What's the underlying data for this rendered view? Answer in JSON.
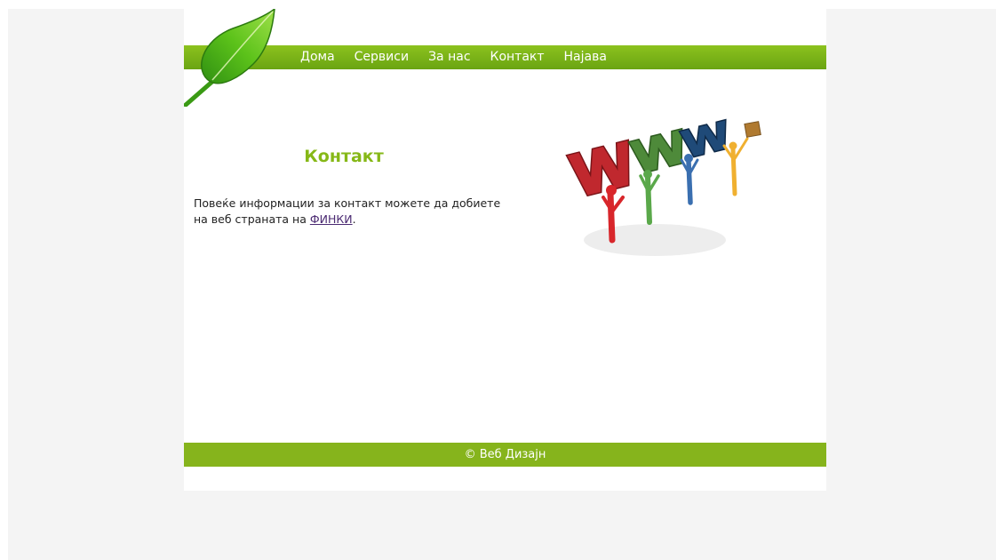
{
  "nav": {
    "items": [
      {
        "label": "Дома"
      },
      {
        "label": "Сервиси"
      },
      {
        "label": "За нас"
      },
      {
        "label": "Контакт"
      },
      {
        "label": "Најава"
      }
    ]
  },
  "content": {
    "title": "Контакт",
    "text_before": "Повеќе информации за контакт можете да добиете на веб страната на ",
    "link_label": "ФИНКИ",
    "text_after": "."
  },
  "images": {
    "logo_icon": "leaf-icon",
    "illustration": "www-figures-illustration"
  },
  "footer": {
    "text": "© Веб Дизајн"
  },
  "colors": {
    "accent_green": "#86b817",
    "link_purple": "#4b2a72",
    "background": "#f4f4f4"
  }
}
